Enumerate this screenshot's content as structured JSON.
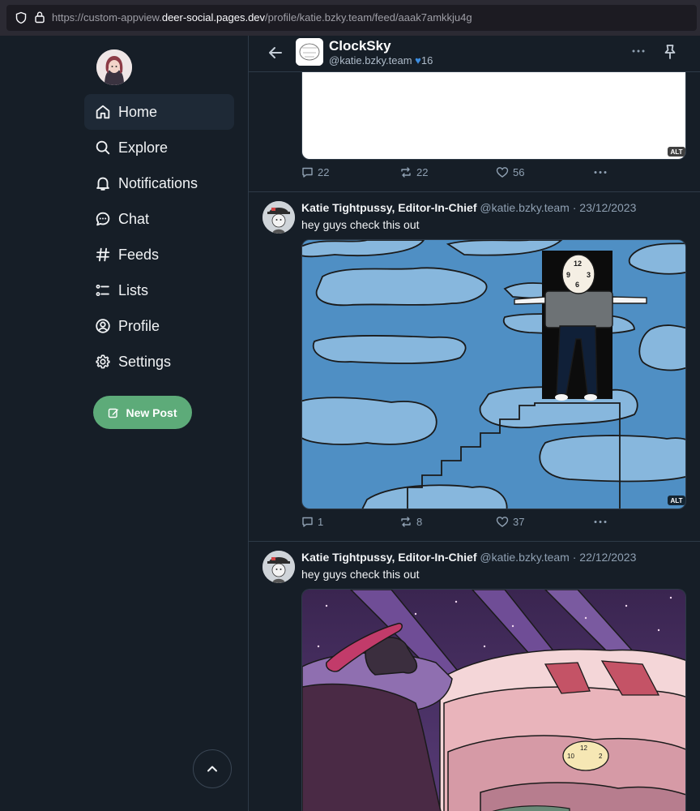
{
  "browser": {
    "url_prefix": "https://custom-appview.",
    "url_domain": "deer-social.pages.dev",
    "url_path": "/profile/katie.bzky.team/feed/aaak7amkkju4g"
  },
  "sidebar": {
    "items": [
      {
        "label": "Home",
        "icon": "home-icon",
        "active": true
      },
      {
        "label": "Explore",
        "icon": "search-icon"
      },
      {
        "label": "Notifications",
        "icon": "bell-icon"
      },
      {
        "label": "Chat",
        "icon": "chat-icon"
      },
      {
        "label": "Feeds",
        "icon": "hash-icon"
      },
      {
        "label": "Lists",
        "icon": "list-icon"
      },
      {
        "label": "Profile",
        "icon": "user-circle-icon"
      },
      {
        "label": "Settings",
        "icon": "gear-icon"
      }
    ],
    "new_post_label": "New Post"
  },
  "feed": {
    "title": "ClockSky",
    "handle": "@katie.bzky.team",
    "likes": "16"
  },
  "previous_post": {
    "alt": "ALT",
    "replies": "22",
    "reposts": "22",
    "likes": "56"
  },
  "posts": [
    {
      "author": "Katie Tightpussy, Editor-In-Chief",
      "handle": "@katie.bzky.team",
      "date": "23/12/2023",
      "text": "hey guys check this out",
      "alt": "ALT",
      "replies": "1",
      "reposts": "8",
      "likes": "37"
    },
    {
      "author": "Katie Tightpussy, Editor-In-Chief",
      "handle": "@katie.bzky.team",
      "date": "22/12/2023",
      "text": "hey guys check this out"
    }
  ],
  "colors": {
    "background": "#161e27",
    "accent_green": "#5dab79",
    "accent_blue": "#3c8de0"
  }
}
